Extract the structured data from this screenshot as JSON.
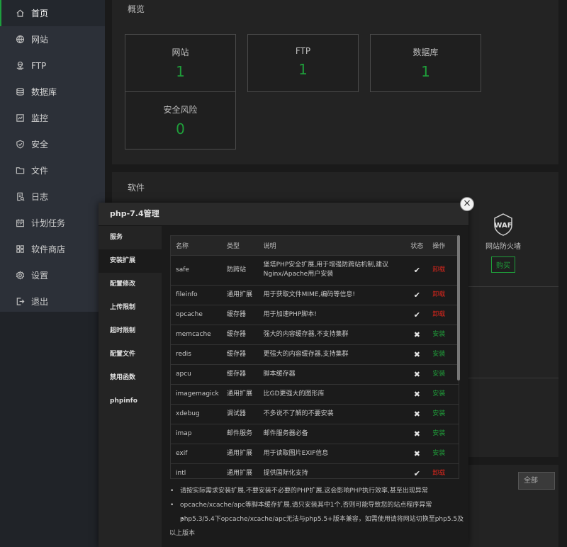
{
  "sidebar": {
    "items": [
      {
        "label": "首页",
        "icon": "home-icon"
      },
      {
        "label": "网站",
        "icon": "globe-icon"
      },
      {
        "label": "FTP",
        "icon": "ftp-icon"
      },
      {
        "label": "数据库",
        "icon": "database-icon"
      },
      {
        "label": "监控",
        "icon": "monitor-icon"
      },
      {
        "label": "安全",
        "icon": "shield-icon"
      },
      {
        "label": "文件",
        "icon": "folder-icon"
      },
      {
        "label": "日志",
        "icon": "log-icon"
      },
      {
        "label": "计划任务",
        "icon": "calendar-icon"
      },
      {
        "label": "软件商店",
        "icon": "apps-icon"
      },
      {
        "label": "设置",
        "icon": "gear-icon"
      },
      {
        "label": "退出",
        "icon": "logout-icon"
      }
    ]
  },
  "overview": {
    "title": "概览",
    "stats": [
      {
        "label": "网站",
        "value": "1"
      },
      {
        "label": "FTP",
        "value": "1"
      },
      {
        "label": "数据库",
        "value": "1"
      },
      {
        "label": "安全风险",
        "value": "0"
      }
    ]
  },
  "software": {
    "title": "软件",
    "waf": {
      "icon_text": "WAF",
      "label": "网站防火墙",
      "buy": "购买"
    }
  },
  "filter": {
    "all": "全部"
  },
  "modal": {
    "title": "php-7.4管理",
    "close": "×",
    "nav": [
      "服务",
      "安装扩展",
      "配置修改",
      "上传限制",
      "超时限制",
      "配置文件",
      "禁用函数",
      "phpinfo"
    ],
    "table": {
      "headers": {
        "name": "名称",
        "type": "类型",
        "desc": "说明",
        "status": "状态",
        "op": "操作"
      },
      "rows": [
        {
          "name": "safe",
          "type": "防跨站",
          "desc": "堡塔PHP安全扩展,用于增强防跨站机制,建议Nginx/Apache用户安装",
          "status": "✔",
          "op": "卸载"
        },
        {
          "name": "fileinfo",
          "type": "通用扩展",
          "desc": "用于获取文件MIME,编码等信息!",
          "status": "✔",
          "op": "卸载"
        },
        {
          "name": "opcache",
          "type": "缓存器",
          "desc": "用于加速PHP脚本!",
          "status": "✔",
          "op": "卸载"
        },
        {
          "name": "memcache",
          "type": "缓存器",
          "desc": "强大的内容缓存器,不支持集群",
          "status": "✖",
          "op": "安装"
        },
        {
          "name": "redis",
          "type": "缓存器",
          "desc": "更强大的内容缓存器,支持集群",
          "status": "✖",
          "op": "安装"
        },
        {
          "name": "apcu",
          "type": "缓存器",
          "desc": "脚本缓存器",
          "status": "✖",
          "op": "安装"
        },
        {
          "name": "imagemagick",
          "type": "通用扩展",
          "desc": "比GD更强大的图形库",
          "status": "✖",
          "op": "安装"
        },
        {
          "name": "xdebug",
          "type": "调试器",
          "desc": "不多说不了解的不要安装",
          "status": "✖",
          "op": "安装"
        },
        {
          "name": "imap",
          "type": "邮件服务",
          "desc": "邮件服务器必备",
          "status": "✖",
          "op": "安装"
        },
        {
          "name": "exif",
          "type": "通用扩展",
          "desc": "用于读取图片EXIF信息",
          "status": "✖",
          "op": "安装"
        },
        {
          "name": "intl",
          "type": "通用扩展",
          "desc": "提供国际化支持",
          "status": "✔",
          "op": "卸载"
        }
      ]
    },
    "notes": [
      "请按实际需求安装扩展,不要安装不必要的PHP扩展,这会影响PHP执行效率,甚至出现异常",
      "opcache/xcache/apc等脚本缓存扩展,请只安装其中1个,否则可能导致您的站点程序异常",
      "php5.3/5.4下opcache/xcache/apc无法与php5.5+版本兼容，如需使用请将网站切换至php5.5及以上版本"
    ]
  },
  "colors": {
    "accent": "#1f9e3a",
    "danger": "#d9261c"
  }
}
